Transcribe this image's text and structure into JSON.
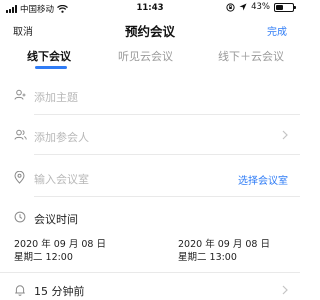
{
  "status_bar": {
    "carrier": "中国移动",
    "time": "11:43",
    "battery": "43%",
    "battery_level": 0.43
  },
  "nav": {
    "cancel_label": "取消",
    "title": "预约会议",
    "done_label": "完成"
  },
  "tabs": [
    {
      "label": "线下会议",
      "active": true
    },
    {
      "label": "听见云会议",
      "active": false
    },
    {
      "label": "线下＋云会议",
      "active": false
    }
  ],
  "form": {
    "subject_placeholder": "添加主题",
    "participants_placeholder": "添加参会人",
    "room_placeholder": "输入会议室",
    "select_room_label": "选择会议室",
    "time_section_label": "会议时间",
    "start": {
      "date": "2020 年 09 月 08 日",
      "weekday_time": "星期二 12:00"
    },
    "end": {
      "date": "2020 年 09 月 08 日",
      "weekday_time": "星期二 13:00"
    },
    "reminder_label": "15 分钟前"
  },
  "icons": {
    "subject": "person-icon",
    "participants": "group-icon",
    "room": "location-pin-icon",
    "time": "clock-icon",
    "reminder": "bell-icon",
    "chevron": "chevron-right-icon"
  },
  "colors": {
    "accent": "#2f7cf6",
    "placeholder": "#b8b8b8",
    "divider": "#e9e9e9"
  }
}
